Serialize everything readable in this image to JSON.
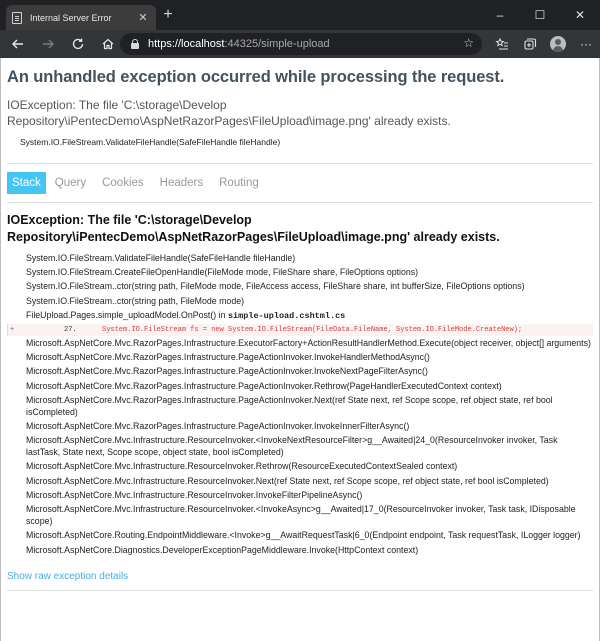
{
  "browser": {
    "tab_title": "Internal Server Error",
    "tab_close": "✕",
    "new_tab": "+",
    "url_host": "https://localhost",
    "url_rest": ":44325/simple-upload",
    "window_controls": [
      "–",
      "☐",
      "✕"
    ],
    "icons": [
      "back-arrow-icon",
      "forward-arrow-icon",
      "refresh-icon",
      "home-icon",
      "lock-icon",
      "star-icon",
      "favorites-icon",
      "collections-icon",
      "profile-avatar",
      "more-icon"
    ]
  },
  "page": {
    "heading": "An unhandled exception occurred while processing the request.",
    "title_error": "IOException: The file 'C:\\storage\\Develop Repository\\iPentecDemo\\AspNetRazorPages\\FileUpload\\image.png' already exists.",
    "location": "System.IO.FileStream.ValidateFileHandle(SafeFileHandle fileHandle)",
    "tabs": [
      {
        "label": "Stack",
        "active": true
      },
      {
        "label": "Query",
        "active": false
      },
      {
        "label": "Cookies",
        "active": false
      },
      {
        "label": "Headers",
        "active": false
      },
      {
        "label": "Routing",
        "active": false
      }
    ],
    "exception_heading": "IOException: The file 'C:\\storage\\Develop Repository\\iPentecDemo\\AspNetRazorPages\\FileUpload\\image.png' already exists.",
    "frames_before": [
      "System.IO.FileStream.ValidateFileHandle(SafeFileHandle fileHandle)",
      "System.IO.FileStream.CreateFileOpenHandle(FileMode mode, FileShare share, FileOptions options)",
      "System.IO.FileStream..ctor(string path, FileMode mode, FileAccess access, FileShare share, int bufferSize, FileOptions options)",
      "System.IO.FileStream..ctor(string path, FileMode mode)"
    ],
    "user_frame": {
      "method": "FileUpload.Pages.simple_uploadModel.OnPost() in ",
      "file": "simple-upload.cshtml.cs"
    },
    "code_line": {
      "expander": "+",
      "number": "27.",
      "code": "System.IO.FileStream fs = new System.IO.FileStream(FileData.FileName, System.IO.FileMode.CreateNew);"
    },
    "frames_after": [
      "Microsoft.AspNetCore.Mvc.RazorPages.Infrastructure.ExecutorFactory+ActionResultHandlerMethod.Execute(object receiver, object[] arguments)",
      "Microsoft.AspNetCore.Mvc.RazorPages.Infrastructure.PageActionInvoker.InvokeHandlerMethodAsync()",
      "Microsoft.AspNetCore.Mvc.RazorPages.Infrastructure.PageActionInvoker.InvokeNextPageFilterAsync()",
      "Microsoft.AspNetCore.Mvc.RazorPages.Infrastructure.PageActionInvoker.Rethrow(PageHandlerExecutedContext context)",
      "Microsoft.AspNetCore.Mvc.RazorPages.Infrastructure.PageActionInvoker.Next(ref State next, ref Scope scope, ref object state, ref bool isCompleted)",
      "Microsoft.AspNetCore.Mvc.RazorPages.Infrastructure.PageActionInvoker.InvokeInnerFilterAsync()",
      "Microsoft.AspNetCore.Mvc.Infrastructure.ResourceInvoker.<InvokeNextResourceFilter>g__Awaited|24_0(ResourceInvoker invoker, Task lastTask, State next, Scope scope, object state, bool isCompleted)",
      "Microsoft.AspNetCore.Mvc.Infrastructure.ResourceInvoker.Rethrow(ResourceExecutedContextSealed context)",
      "Microsoft.AspNetCore.Mvc.Infrastructure.ResourceInvoker.Next(ref State next, ref Scope scope, ref object state, ref bool isCompleted)",
      "Microsoft.AspNetCore.Mvc.Infrastructure.ResourceInvoker.InvokeFilterPipelineAsync()",
      "Microsoft.AspNetCore.Mvc.Infrastructure.ResourceInvoker.<InvokeAsync>g__Awaited|17_0(ResourceInvoker invoker, Task task, IDisposable scope)",
      "Microsoft.AspNetCore.Routing.EndpointMiddleware.<Invoke>g__AwaitRequestTask|6_0(Endpoint endpoint, Task requestTask, ILogger logger)",
      "Microsoft.AspNetCore.Diagnostics.DeveloperExceptionPageMiddleware.Invoke(HttpContext context)"
    ],
    "raw_link": "Show raw exception details"
  },
  "colors": {
    "heading": "#44525e",
    "active_tab": "#44c5f2",
    "link": "#44b0e8",
    "code": "#d0443e"
  }
}
